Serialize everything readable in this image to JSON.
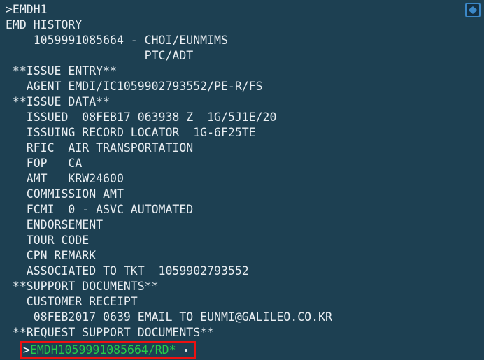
{
  "terminal": {
    "background_color": "#1d4052",
    "text_color": "#e9eef2",
    "accent_green": "#24cc49",
    "highlight_border_color": "#ee1111",
    "scroll_widget_color": "#3b88c8",
    "lines": [
      ">EMDH1",
      "EMD HISTORY",
      "    1059991085664 - CHOI/EUNMIMS",
      "                    PTC/ADT",
      " **ISSUE ENTRY**",
      "   AGENT EMDI/IC1059902793552/PE-R/FS",
      " **ISSUE DATA**",
      "   ISSUED  08FEB17 063938 Z  1G/5J1E/20",
      "   ISSUING RECORD LOCATOR  1G-6F25TE",
      "   RFIC  AIR TRANSPORTATION",
      "   FOP   CA",
      "   AMT   KRW24600",
      "   COMMISSION AMT",
      "   FCMI  0 - ASVC AUTOMATED",
      "   ENDORSEMENT",
      "   TOUR CODE",
      "   CPN REMARK",
      "   ASSOCIATED TO TKT  1059902793552",
      " **SUPPORT DOCUMENTS**",
      "   CUSTOMER RECEIPT",
      "    08FEB2017 0639 EMAIL TO EUNMI@GALILEO.CO.KR",
      " **REQUEST SUPPORT DOCUMENTS**"
    ],
    "command_prompt": {
      "caret": ">",
      "command": "EMDH1059991085664/RD*"
    },
    "scroll_widget": {
      "name": "scroll-up-down-widget"
    }
  }
}
